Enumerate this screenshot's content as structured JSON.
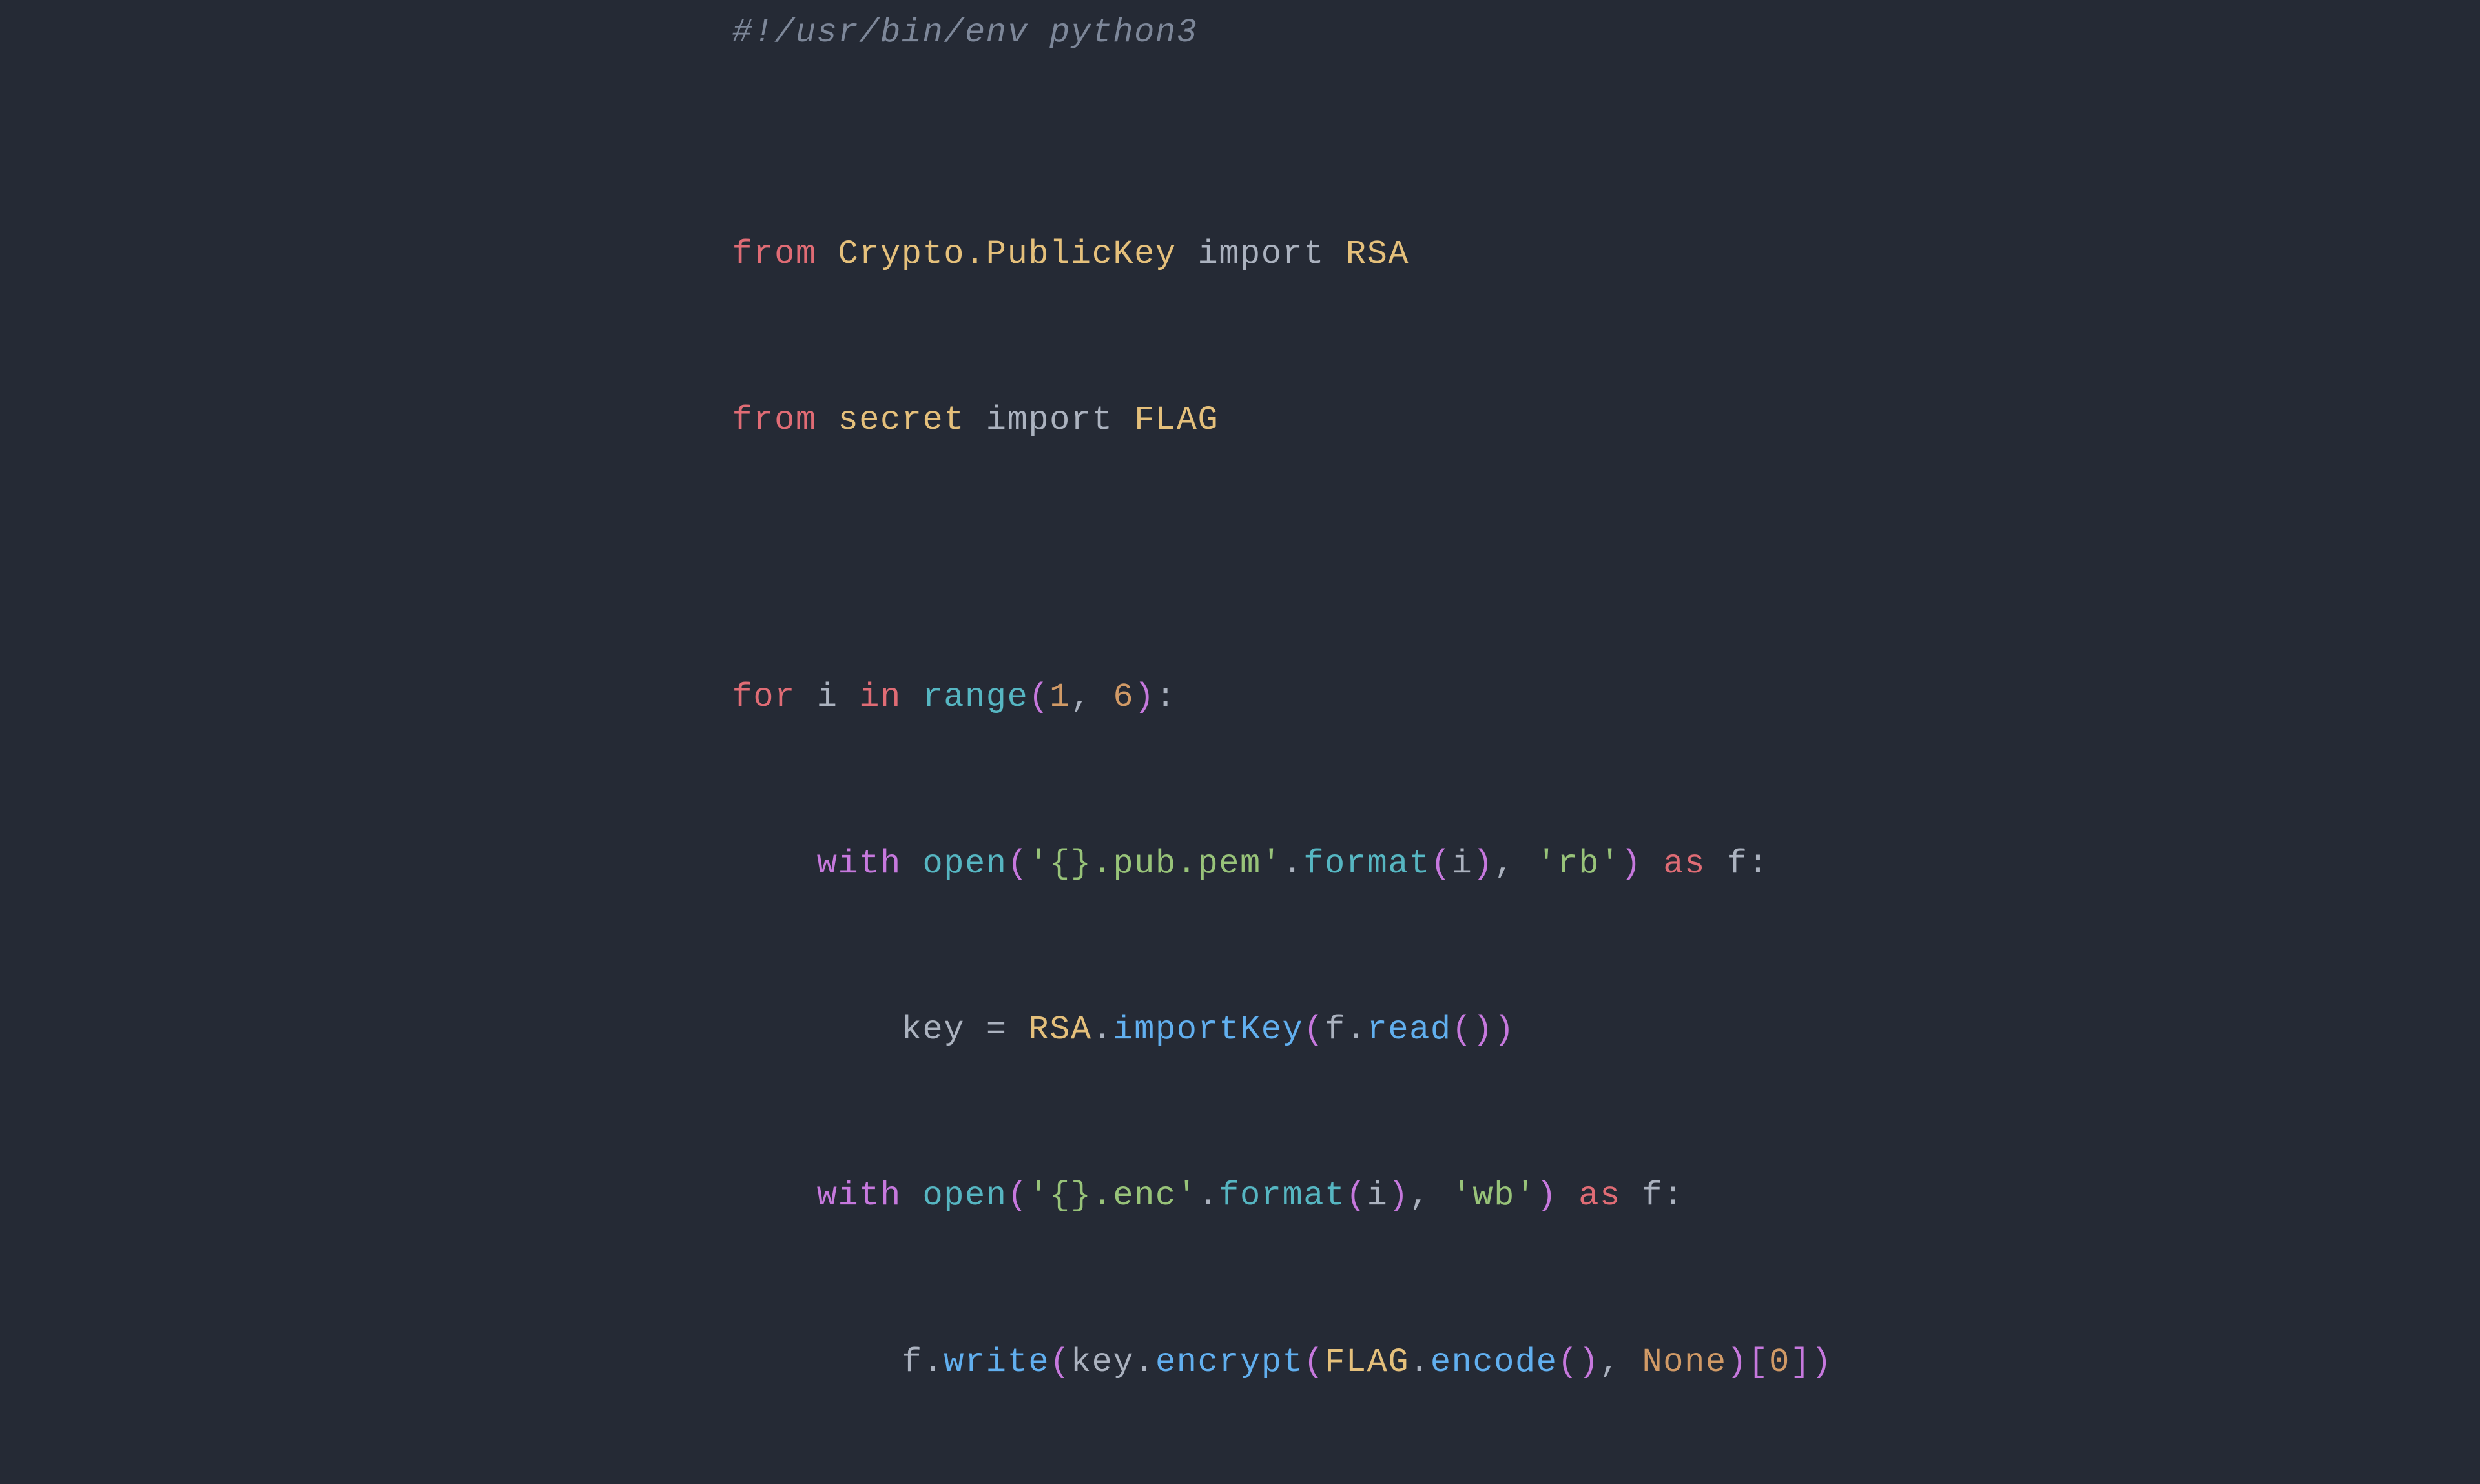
{
  "code": {
    "lines": [
      {
        "id": "shebang",
        "text": "#!/usr/bin/env python3"
      },
      {
        "id": "empty1",
        "text": ""
      },
      {
        "id": "import1",
        "text": "from Crypto.PublicKey import RSA"
      },
      {
        "id": "import2",
        "text": "from secret import FLAG"
      },
      {
        "id": "empty2",
        "text": ""
      },
      {
        "id": "empty3",
        "text": ""
      },
      {
        "id": "for_loop",
        "text": "for i in range(1, 6):"
      },
      {
        "id": "with1",
        "text": "    with open('{}.pub.pem'.format(i), 'rb') as f:"
      },
      {
        "id": "key_assign",
        "text": "        key = RSA.importKey(f.read())"
      },
      {
        "id": "with2",
        "text": "    with open('{}.enc'.format(i), 'wb') as f:"
      },
      {
        "id": "fwrite",
        "text": "        f.write(key.encrypt(FLAG.encode(), None)[0])"
      }
    ]
  }
}
